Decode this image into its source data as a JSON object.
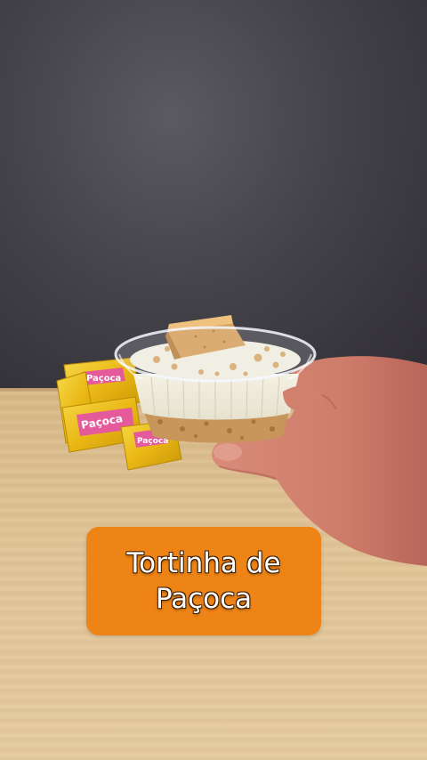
{
  "caption": {
    "line1": "Tortinha de",
    "line2": "Paçoca"
  },
  "colors": {
    "caption_bg": "#ef8416",
    "caption_text": "#ffffff",
    "wrapper_yellow": "#f2c81a"
  },
  "wrappers": [
    {
      "label": "Paçoca"
    },
    {
      "label": "Paçoca"
    },
    {
      "label": "Paçoca"
    }
  ]
}
